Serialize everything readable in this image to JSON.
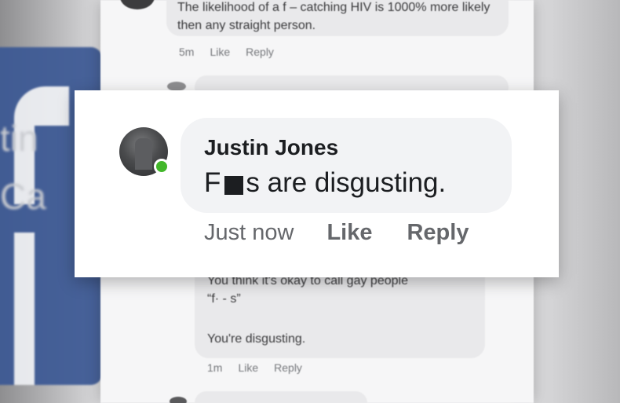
{
  "background": {
    "ghost_text": "tin\nCa",
    "colors": {
      "brand_blue": "#3b5894"
    }
  },
  "background_comments": [
    {
      "text": "The likelihood of a f ‒ catching HIV is 1000% more likely then any straight person.",
      "time": "5m",
      "like": "Like",
      "reply": "Reply"
    },
    {
      "line1": "You think it's okay to call gay people",
      "line2": "“f· - s”",
      "line3": "You're disgusting.",
      "time": "1m",
      "like": "Like",
      "reply": "Reply"
    }
  ],
  "highlighted_comment": {
    "author": "Justin Jones",
    "text_start": "F",
    "text_end": "s are disgusting.",
    "time": "Just now",
    "like": "Like",
    "reply": "Reply",
    "online_status_color": "#42b72a"
  }
}
